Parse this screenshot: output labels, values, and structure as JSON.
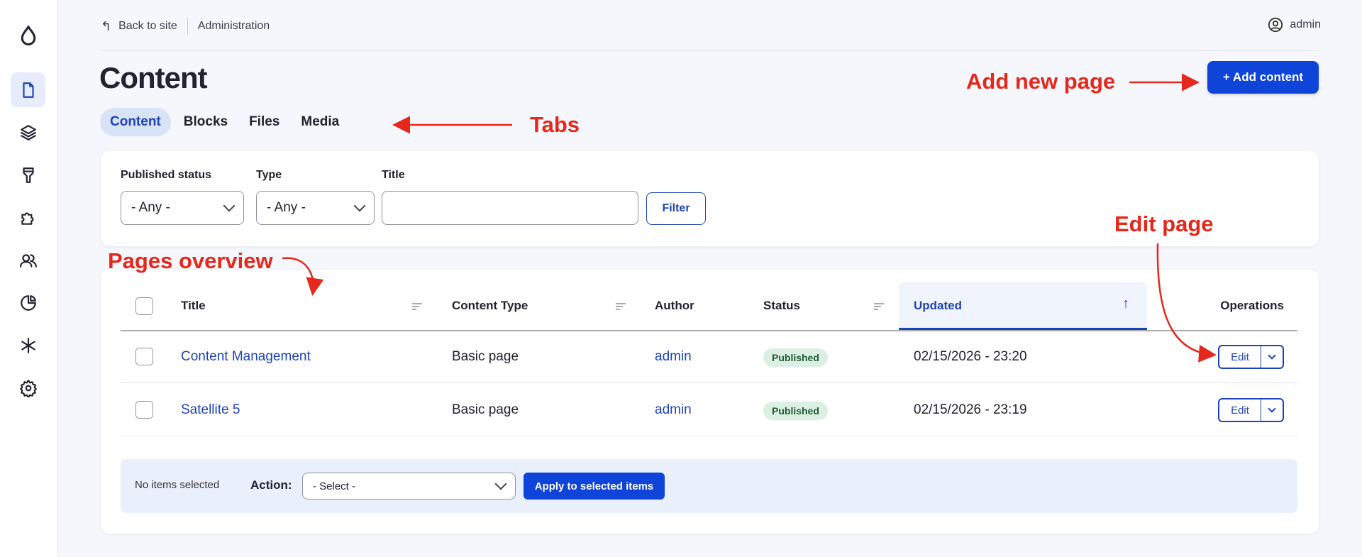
{
  "topbar": {
    "back": "Back to site",
    "admin_link": "Administration",
    "user": "admin"
  },
  "page": {
    "title": "Content",
    "add_button": "+ Add content"
  },
  "tabs": [
    {
      "label": "Content",
      "active": true
    },
    {
      "label": "Blocks"
    },
    {
      "label": "Files"
    },
    {
      "label": "Media"
    }
  ],
  "filters": {
    "status_label": "Published status",
    "status_value": "- Any -",
    "type_label": "Type",
    "type_value": "- Any -",
    "title_label": "Title",
    "title_value": "",
    "filter_button": "Filter"
  },
  "table": {
    "columns": [
      "Title",
      "Content Type",
      "Author",
      "Status",
      "Updated",
      "Operations"
    ],
    "rows": [
      {
        "title": "Content Management",
        "type": "Basic page",
        "author": "admin",
        "status": "Published",
        "updated": "02/15/2026 - 23:20",
        "op": "Edit"
      },
      {
        "title": "Satellite 5",
        "type": "Basic page",
        "author": "admin",
        "status": "Published",
        "updated": "02/15/2026 - 23:19",
        "op": "Edit"
      }
    ]
  },
  "bulk": {
    "selected": "No items selected",
    "action_label": "Action:",
    "action_value": "- Select -",
    "apply": "Apply to selected items"
  },
  "annotations": {
    "add": "Add new page",
    "tabs": "Tabs",
    "edit": "Edit page",
    "overview": "Pages overview"
  },
  "colors": {
    "accent": "#1e44b8",
    "button": "#0e44d8",
    "annotation": "#e5281b"
  }
}
